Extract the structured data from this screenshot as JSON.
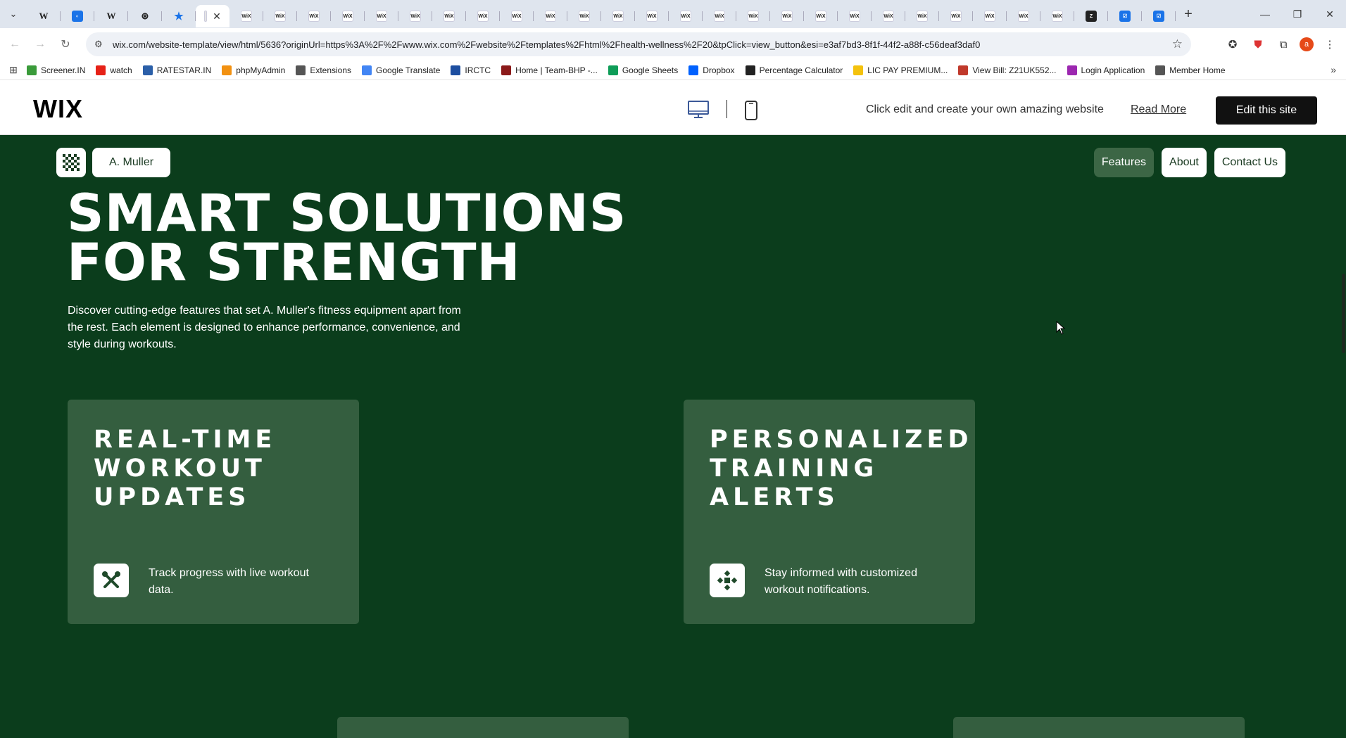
{
  "browser": {
    "tabs": [
      {
        "icon": "wiki-icon",
        "glyph": "W",
        "kind": "w"
      },
      {
        "icon": "globe-icon",
        "glyph": "◐",
        "kind": "blue"
      },
      {
        "icon": "wiki-icon",
        "glyph": "W",
        "kind": "w"
      },
      {
        "icon": "openai-icon",
        "glyph": "⊛",
        "kind": "w"
      },
      {
        "icon": "star-icon",
        "glyph": "★",
        "kind": "star"
      },
      {
        "icon": "wix-icon",
        "glyph": "",
        "kind": "active"
      },
      {
        "icon": "wix-icon",
        "glyph": "WiX"
      },
      {
        "icon": "wix-icon",
        "glyph": "WiX"
      },
      {
        "icon": "wix-icon",
        "glyph": "WiX"
      },
      {
        "icon": "wix-icon",
        "glyph": "WiX"
      },
      {
        "icon": "wix-icon",
        "glyph": "WiX"
      },
      {
        "icon": "wix-icon",
        "glyph": "WiX"
      },
      {
        "icon": "wix-icon",
        "glyph": "WiX"
      },
      {
        "icon": "wix-icon",
        "glyph": "WiX"
      },
      {
        "icon": "wix-icon",
        "glyph": "WiX"
      },
      {
        "icon": "wix-icon",
        "glyph": "WiX"
      },
      {
        "icon": "wix-icon",
        "glyph": "WiX"
      },
      {
        "icon": "wix-icon",
        "glyph": "WiX"
      },
      {
        "icon": "wix-icon",
        "glyph": "WiX"
      },
      {
        "icon": "wix-icon",
        "glyph": "WiX"
      },
      {
        "icon": "wix-icon",
        "glyph": "WiX"
      },
      {
        "icon": "wix-icon",
        "glyph": "WiX"
      },
      {
        "icon": "wix-icon",
        "glyph": "WiX"
      },
      {
        "icon": "wix-icon",
        "glyph": "WiX"
      },
      {
        "icon": "wix-icon",
        "glyph": "WiX"
      },
      {
        "icon": "wix-icon",
        "glyph": "WiX"
      },
      {
        "icon": "wix-icon",
        "glyph": "WiX"
      },
      {
        "icon": "wix-icon",
        "glyph": "WiX"
      },
      {
        "icon": "wix-icon",
        "glyph": "WiX"
      },
      {
        "icon": "wix-icon",
        "glyph": "WiX"
      },
      {
        "icon": "wix-icon",
        "glyph": "WiX"
      },
      {
        "icon": "zed-icon",
        "glyph": "Z",
        "kind": "dark"
      },
      {
        "icon": "checkbox-icon",
        "glyph": "☑",
        "kind": "blue"
      },
      {
        "icon": "checkbox-icon",
        "glyph": "☑",
        "kind": "blue"
      }
    ],
    "new_tab": "+",
    "url": "wix.com/website-template/view/html/5636?originUrl=https%3A%2F%2Fwww.wix.com%2Fwebsite%2Ftemplates%2Fhtml%2Fhealth-wellness%2F20&tpClick=view_button&esi=e3af7bd3-8f1f-44f2-a88f-c56deaf3daf0",
    "profile_initial": "a",
    "bookmarks": [
      {
        "label": "Screener.IN",
        "icon": "chart-icon",
        "color": "#3a9b3a"
      },
      {
        "label": "watch",
        "icon": "youtube-icon",
        "color": "#e62117"
      },
      {
        "label": "RATESTAR.IN",
        "icon": "ratestar-icon",
        "color": "#2b5fa8"
      },
      {
        "label": "phpMyAdmin",
        "icon": "phpmyadmin-icon",
        "color": "#f29111"
      },
      {
        "label": "Extensions",
        "icon": "puzzle-icon",
        "color": "#555555"
      },
      {
        "label": "Google Translate",
        "icon": "translate-icon",
        "color": "#4285f4"
      },
      {
        "label": "IRCTC",
        "icon": "irctc-icon",
        "color": "#1d4ea0"
      },
      {
        "label": "Home | Team-BHP -...",
        "icon": "teambhp-icon",
        "color": "#8b1a1a"
      },
      {
        "label": "Google Sheets",
        "icon": "sheets-icon",
        "color": "#0f9d58"
      },
      {
        "label": "Dropbox",
        "icon": "dropbox-icon",
        "color": "#0061fe"
      },
      {
        "label": "Percentage Calculator",
        "icon": "percent-icon",
        "color": "#222222"
      },
      {
        "label": "LIC PAY PREMIUM...",
        "icon": "lic-icon",
        "color": "#f4c20d"
      },
      {
        "label": "View Bill: Z21UK552...",
        "icon": "bill-icon",
        "color": "#c0392b"
      },
      {
        "label": "Login Application",
        "icon": "login-icon",
        "color": "#9c27b0"
      },
      {
        "label": "Member Home",
        "icon": "globe-icon",
        "color": "#555555"
      }
    ]
  },
  "wix": {
    "logo": "WIX",
    "tagline": "Click edit and create your own amazing website",
    "read_more": "Read More",
    "edit_button": "Edit this site"
  },
  "site": {
    "brand": "A. Muller",
    "nav": [
      {
        "label": "Features",
        "active": true
      },
      {
        "label": "About",
        "active": false
      },
      {
        "label": "Contact Us",
        "active": false
      }
    ],
    "hero": {
      "title_line1": "SMART SOLUTIONS",
      "title_line2": "FOR STRENGTH",
      "description": "Discover cutting-edge features that set A. Muller's fitness equipment apart from the rest. Each element is designed to enhance performance, convenience, and style during workouts."
    },
    "cards": [
      {
        "title_lines": [
          "REAL-TIME",
          "WORKOUT",
          "UPDATES"
        ],
        "description": "Track progress with live workout data.",
        "icon": "tools-icon"
      },
      {
        "title_lines": [
          "PERSONALIZED",
          "TRAINING",
          "ALERTS"
        ],
        "description": "Stay informed with customized workout notifications.",
        "icon": "move-icon"
      }
    ]
  },
  "colors": {
    "site_background": "#0b3d1c",
    "card_background": "#345e3f",
    "nav_active": "#3c6645",
    "wix_button": "#111111"
  }
}
